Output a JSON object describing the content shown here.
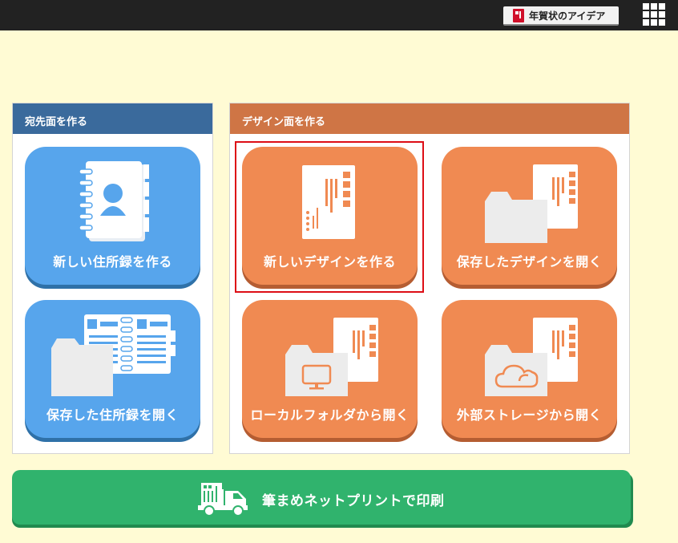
{
  "topbar": {
    "ideas_label": "年賀状のアイデア"
  },
  "address_panel": {
    "title": "宛先面を作る",
    "tiles": [
      {
        "label": "新しい住所録を作る",
        "icon": "address-book-icon"
      },
      {
        "label": "保存した住所録を開く",
        "icon": "folder-address-book-icon"
      }
    ]
  },
  "design_panel": {
    "title": "デザイン面を作る",
    "tiles": [
      {
        "label": "新しいデザインを作る",
        "icon": "postcard-icon",
        "selected": true
      },
      {
        "label": "保存したデザインを開く",
        "icon": "folder-postcard-icon"
      },
      {
        "label": "ローカルフォルダから開く",
        "icon": "local-folder-icon"
      },
      {
        "label": "外部ストレージから開く",
        "icon": "cloud-folder-icon"
      }
    ]
  },
  "print_button": {
    "label": "筆まめネットプリントで印刷",
    "icon": "delivery-truck-icon"
  },
  "colors": {
    "blue_tile": "#57a5ec",
    "orange_tile": "#f08a52",
    "green_button": "#30b36d",
    "selection": "#dd0e16"
  }
}
